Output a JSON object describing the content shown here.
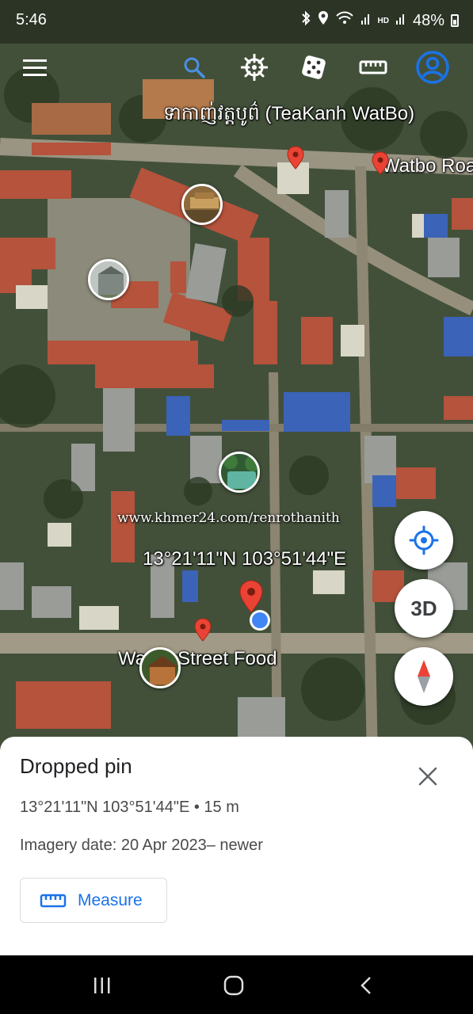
{
  "status_bar": {
    "time": "5:46",
    "battery": "48%",
    "icons": [
      "bluetooth-icon",
      "location-icon",
      "wifi-icon",
      "signal-icon",
      "hd-icon",
      "signal-icon",
      "battery-icon"
    ],
    "hd_label": "HD"
  },
  "toolbar": {
    "items": [
      "menu-icon",
      "search-icon",
      "voyager-wheel-icon",
      "dice-icon",
      "ruler-icon",
      "account-icon"
    ]
  },
  "map": {
    "place_label": "ទាកាញ់វត្តបូព៌ (TeaKanh WatBo)",
    "road_label": "Watbo Roa",
    "food_label": "Watbo Street Food",
    "coordinate_label": "13°21'11\"N 103°51'44\"E",
    "watermark": "www.khmer24.com/renrothanith",
    "three_d_label": "3D"
  },
  "sheet": {
    "title": "Dropped pin",
    "coords": "13°21'11\"N 103°51'44\"E • 15 m",
    "imagery": "Imagery date: 20 Apr 2023– newer",
    "measure_label": "Measure"
  },
  "colors": {
    "accent": "#1a73e8",
    "pin_red": "#ea4335",
    "location_blue": "#4285f4"
  }
}
